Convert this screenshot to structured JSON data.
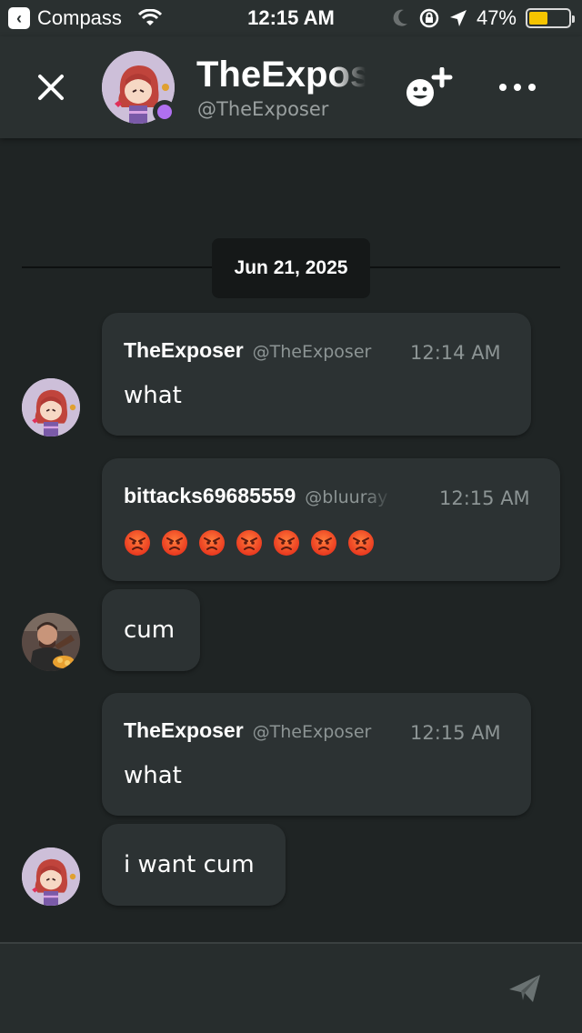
{
  "status_bar": {
    "carrier": "Compass",
    "time": "12:15 AM",
    "battery": "47%",
    "battery_level": 0.47,
    "battery_color": "#f5c400"
  },
  "header": {
    "name": "TheExposer",
    "handle": "@TheExposer",
    "status_color": "#b070f0"
  },
  "date_divider": "Jun 21, 2025",
  "messages": [
    {
      "author": "TheExposer",
      "handle": "@TheExposer",
      "time": "12:14 AM",
      "lines": [
        "what"
      ]
    },
    {
      "author": "bittacks69685559",
      "handle": "@bluuray",
      "time": "12:15 AM",
      "emojis": [
        "😡",
        "😡",
        "😡",
        "😡",
        "😡",
        "😡",
        "😡"
      ],
      "lines": [
        "cum"
      ]
    },
    {
      "author": "TheExposer",
      "handle": "@TheExposer",
      "time": "12:15 AM",
      "lines": [
        "what",
        "i want cum"
      ]
    }
  ],
  "composer": {
    "placeholder": ""
  },
  "icons": {
    "close": "close-icon",
    "add_friend": "add-friend-icon",
    "more": "more-icon",
    "send": "send-icon",
    "wifi": "wifi-icon",
    "moon": "moon-icon",
    "rotation_lock": "rotation-lock-icon",
    "location": "location-icon"
  }
}
